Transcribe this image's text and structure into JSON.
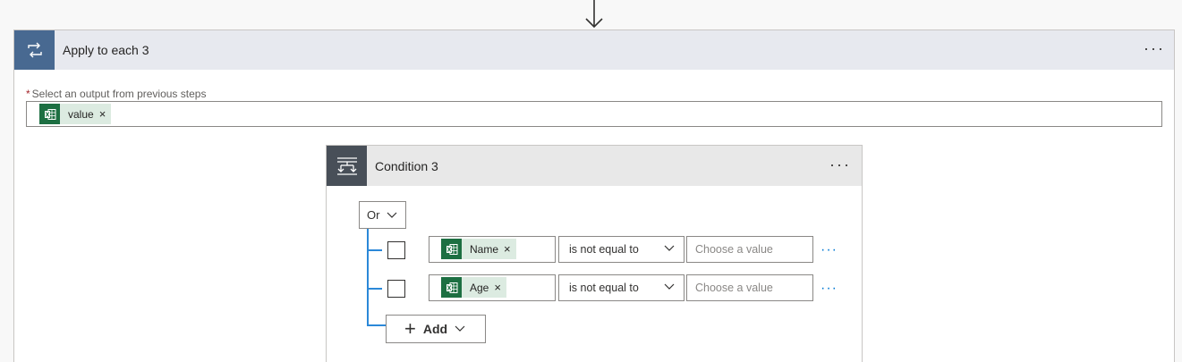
{
  "apply": {
    "title": "Apply to each 3",
    "menu": "···",
    "field_required_mark": "*",
    "field_label": "Select an output from previous steps",
    "token": {
      "label": "value",
      "close": "×"
    }
  },
  "condition": {
    "title": "Condition 3",
    "menu": "···",
    "group_operator": "Or",
    "rows": [
      {
        "field": "Name",
        "close": "×",
        "operator": "is not equal to",
        "value_placeholder": "Choose a value",
        "menu": "···"
      },
      {
        "field": "Age",
        "close": "×",
        "operator": "is not equal to",
        "value_placeholder": "Choose a value",
        "menu": "···"
      }
    ],
    "add_label": "Add"
  },
  "colors": {
    "apply_accent": "#486991",
    "condition_accent": "#484f58",
    "excel_green": "#1d6f42",
    "token_bg": "#dcebe1",
    "tree_blue": "#2b88d8"
  },
  "icons": {
    "flow_arrow": "arrow-down-icon",
    "apply_icon": "loop-icon",
    "condition_icon": "condition-icon",
    "token_icon": "excel-icon",
    "dropdown": "chevron-down-icon",
    "add": "plus-icon"
  }
}
